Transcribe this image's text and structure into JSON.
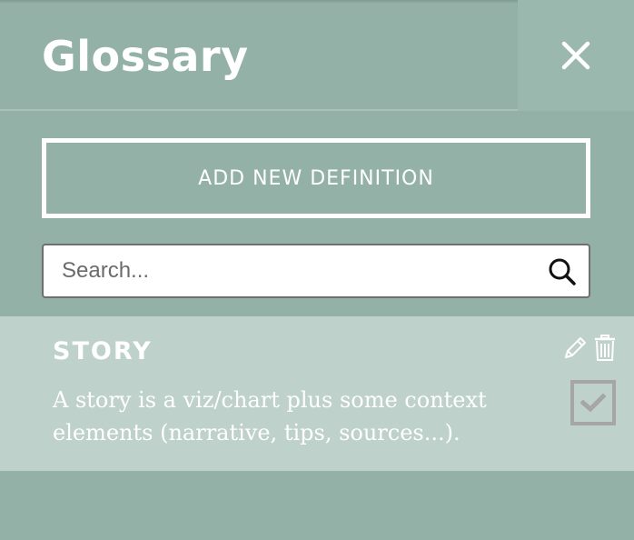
{
  "header": {
    "title": "Glossary",
    "close_icon": "close-icon"
  },
  "actions": {
    "add_definition_label": "ADD NEW DEFINITION"
  },
  "search": {
    "placeholder": "Search...",
    "value": "",
    "icon": "search-icon"
  },
  "entries": [
    {
      "term": "STORY",
      "definition": "A story is a viz/chart plus some context elements (narrative, tips, sources...).",
      "checked": true,
      "icons": [
        "pencil-icon",
        "trash-icon",
        "checkmark-icon"
      ]
    }
  ],
  "colors": {
    "panel_background": "#93b1a7",
    "close_button_background": "#9bb8ae",
    "entry_background": "#bfd1cb",
    "text": "#ffffff",
    "checkbox_border": "#a6a6a6"
  }
}
